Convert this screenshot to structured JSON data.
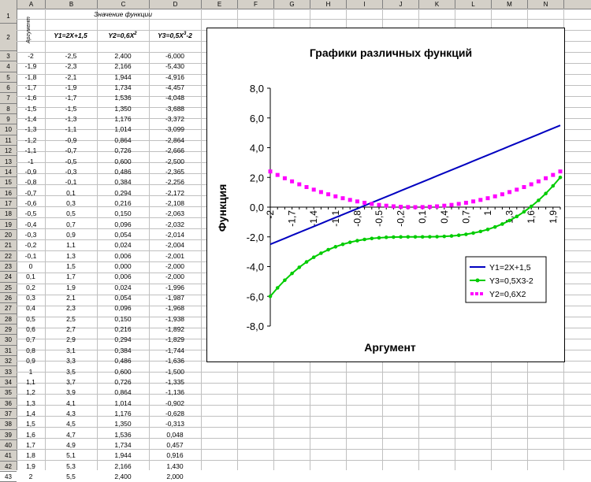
{
  "columns": [
    "A",
    "B",
    "C",
    "D",
    "E",
    "F",
    "G",
    "H",
    "I",
    "J",
    "K",
    "L",
    "M",
    "N"
  ],
  "header": {
    "merged_title": "Значение функции",
    "arg_label": "Аргумент",
    "col_b": "Y1=2X+1,5",
    "col_c": "Y2=0,6X",
    "col_c_sup": "2",
    "col_d": "Y3=0,5X",
    "col_d_sup": "3",
    "col_d_tail": "-2"
  },
  "rows": [
    [
      "-2",
      "-2,5",
      "2,400",
      "-6,000"
    ],
    [
      "-1,9",
      "-2,3",
      "2,166",
      "-5,430"
    ],
    [
      "-1,8",
      "-2,1",
      "1,944",
      "-4,916"
    ],
    [
      "-1,7",
      "-1,9",
      "1,734",
      "-4,457"
    ],
    [
      "-1,6",
      "-1,7",
      "1,536",
      "-4,048"
    ],
    [
      "-1,5",
      "-1,5",
      "1,350",
      "-3,688"
    ],
    [
      "-1,4",
      "-1,3",
      "1,176",
      "-3,372"
    ],
    [
      "-1,3",
      "-1,1",
      "1,014",
      "-3,099"
    ],
    [
      "-1,2",
      "-0,9",
      "0,864",
      "-2,864"
    ],
    [
      "-1,1",
      "-0,7",
      "0,726",
      "-2,666"
    ],
    [
      "-1",
      "-0,5",
      "0,600",
      "-2,500"
    ],
    [
      "-0,9",
      "-0,3",
      "0,486",
      "-2,365"
    ],
    [
      "-0,8",
      "-0,1",
      "0,384",
      "-2,256"
    ],
    [
      "-0,7",
      "0,1",
      "0,294",
      "-2,172"
    ],
    [
      "-0,6",
      "0,3",
      "0,216",
      "-2,108"
    ],
    [
      "-0,5",
      "0,5",
      "0,150",
      "-2,063"
    ],
    [
      "-0,4",
      "0,7",
      "0,096",
      "-2,032"
    ],
    [
      "-0,3",
      "0,9",
      "0,054",
      "-2,014"
    ],
    [
      "-0,2",
      "1,1",
      "0,024",
      "-2,004"
    ],
    [
      "-0,1",
      "1,3",
      "0,006",
      "-2,001"
    ],
    [
      "0",
      "1,5",
      "0,000",
      "-2,000"
    ],
    [
      "0,1",
      "1,7",
      "0,006",
      "-2,000"
    ],
    [
      "0,2",
      "1,9",
      "0,024",
      "-1,996"
    ],
    [
      "0,3",
      "2,1",
      "0,054",
      "-1,987"
    ],
    [
      "0,4",
      "2,3",
      "0,096",
      "-1,968"
    ],
    [
      "0,5",
      "2,5",
      "0,150",
      "-1,938"
    ],
    [
      "0,6",
      "2,7",
      "0,216",
      "-1,892"
    ],
    [
      "0,7",
      "2,9",
      "0,294",
      "-1,829"
    ],
    [
      "0,8",
      "3,1",
      "0,384",
      "-1,744"
    ],
    [
      "0,9",
      "3,3",
      "0,486",
      "-1,636"
    ],
    [
      "1",
      "3,5",
      "0,600",
      "-1,500"
    ],
    [
      "1,1",
      "3,7",
      "0,726",
      "-1,335"
    ],
    [
      "1,2",
      "3,9",
      "0,864",
      "-1,136"
    ],
    [
      "1,3",
      "4,1",
      "1,014",
      "-0,902"
    ],
    [
      "1,4",
      "4,3",
      "1,176",
      "-0,628"
    ],
    [
      "1,5",
      "4,5",
      "1,350",
      "-0,313"
    ],
    [
      "1,6",
      "4,7",
      "1,536",
      "0,048"
    ],
    [
      "1,7",
      "4,9",
      "1,734",
      "0,457"
    ],
    [
      "1,8",
      "5,1",
      "1,944",
      "0,916"
    ],
    [
      "1,9",
      "5,3",
      "2,166",
      "1,430"
    ],
    [
      "2",
      "5,5",
      "2,400",
      "2,000"
    ]
  ],
  "chart_data": {
    "type": "line",
    "title": "Графики различных функций",
    "xlabel": "Аргумент",
    "ylabel": "Функция",
    "ylim": [
      -8,
      8
    ],
    "yticks": [
      "8,0",
      "6,0",
      "4,0",
      "2,0",
      "0,0",
      "-2,0",
      "-4,0",
      "-6,0",
      "-8,0"
    ],
    "xtick_labels": [
      "-2",
      "-1,7",
      "-1,4",
      "-1,1",
      "-0,8",
      "-0,5",
      "-0,2",
      "0,1",
      "0,4",
      "0,7",
      "1",
      "1,3",
      "1,6",
      "1,9"
    ],
    "x": [
      -2,
      -1.9,
      -1.8,
      -1.7,
      -1.6,
      -1.5,
      -1.4,
      -1.3,
      -1.2,
      -1.1,
      -1,
      -0.9,
      -0.8,
      -0.7,
      -0.6,
      -0.5,
      -0.4,
      -0.3,
      -0.2,
      -0.1,
      0,
      0.1,
      0.2,
      0.3,
      0.4,
      0.5,
      0.6,
      0.7,
      0.8,
      0.9,
      1,
      1.1,
      1.2,
      1.3,
      1.4,
      1.5,
      1.6,
      1.7,
      1.8,
      1.9,
      2
    ],
    "series": [
      {
        "name": "Y1=2X+1,5",
        "color": "#0000c0",
        "marker": "none",
        "values": [
          -2.5,
          -2.3,
          -2.1,
          -1.9,
          -1.7,
          -1.5,
          -1.3,
          -1.1,
          -0.9,
          -0.7,
          -0.5,
          -0.3,
          -0.1,
          0.1,
          0.3,
          0.5,
          0.7,
          0.9,
          1.1,
          1.3,
          1.5,
          1.7,
          1.9,
          2.1,
          2.3,
          2.5,
          2.7,
          2.9,
          3.1,
          3.3,
          3.5,
          3.7,
          3.9,
          4.1,
          4.3,
          4.5,
          4.7,
          4.9,
          5.1,
          5.3,
          5.5
        ]
      },
      {
        "name": "Y3=0,5X3-2",
        "color": "#00cc00",
        "marker": "circle",
        "values": [
          -6,
          -5.43,
          -4.916,
          -4.457,
          -4.048,
          -3.688,
          -3.372,
          -3.099,
          -2.864,
          -2.666,
          -2.5,
          -2.365,
          -2.256,
          -2.172,
          -2.108,
          -2.063,
          -2.032,
          -2.014,
          -2.004,
          -2.001,
          -2,
          -2,
          -1.996,
          -1.987,
          -1.968,
          -1.938,
          -1.892,
          -1.829,
          -1.744,
          -1.636,
          -1.5,
          -1.335,
          -1.136,
          -0.902,
          -0.628,
          -0.313,
          0.048,
          0.457,
          0.916,
          1.43,
          2
        ]
      },
      {
        "name": "Y2=0,6X2",
        "color": "#ff00ff",
        "marker": "square",
        "values": [
          2.4,
          2.166,
          1.944,
          1.734,
          1.536,
          1.35,
          1.176,
          1.014,
          0.864,
          0.726,
          0.6,
          0.486,
          0.384,
          0.294,
          0.216,
          0.15,
          0.096,
          0.054,
          0.024,
          0.006,
          0,
          0.006,
          0.024,
          0.054,
          0.096,
          0.15,
          0.216,
          0.294,
          0.384,
          0.486,
          0.6,
          0.726,
          0.864,
          1.014,
          1.176,
          1.35,
          1.536,
          1.734,
          1.944,
          2.166,
          2.4
        ]
      }
    ]
  }
}
